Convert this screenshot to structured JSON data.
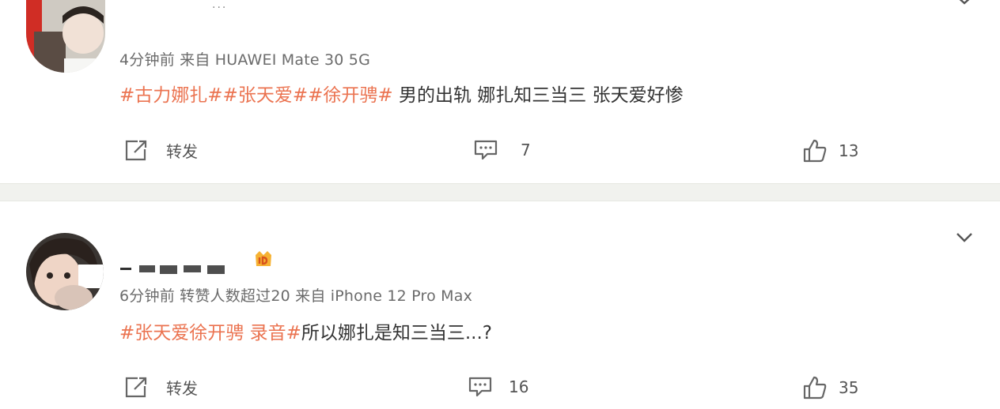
{
  "posts": [
    {
      "meta": "4分钟前  来自 HUAWEI Mate 30 5G",
      "content": {
        "tag": "#古力娜扎##张天爱##徐开骋#",
        "text": " 男的出轨 娜扎知三当三 张天爱好惨"
      },
      "actions": {
        "repost_label": "转发",
        "comment_count": "7",
        "like_count": "13"
      }
    },
    {
      "meta": "6分钟前  转赞人数超过20  来自 iPhone 12 Pro Max",
      "content": {
        "tag": "#张天爱徐开骋 录音#",
        "text": "所以娜扎是知三当三...?"
      },
      "actions": {
        "repost_label": "转发",
        "comment_count": "16",
        "like_count": "35"
      }
    }
  ],
  "icons": {
    "repost": "repost-icon",
    "comment": "comment-icon",
    "like": "thumbs-up-icon",
    "menu": "chevron-down-icon",
    "more": "more-dots-icon",
    "vip": "vip-badge-icon"
  },
  "colors": {
    "tag": "#eb7350",
    "text": "#333333",
    "meta": "#6b6b6b",
    "separator": "#f1f2ee"
  }
}
